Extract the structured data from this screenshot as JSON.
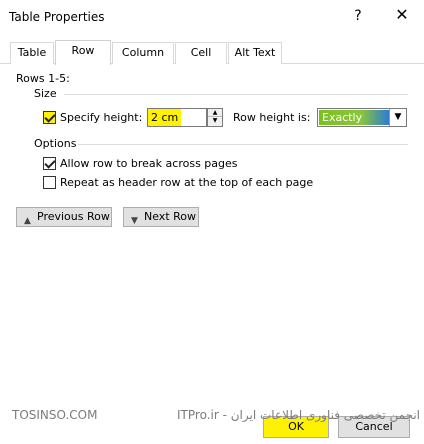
{
  "window": {
    "title": "Table Properties",
    "help_glyph": "?",
    "close_glyph": "✕"
  },
  "tabs": [
    {
      "label": "Table"
    },
    {
      "label": "Row"
    },
    {
      "label": "Column"
    },
    {
      "label": "Cell"
    },
    {
      "label": "Alt Text"
    }
  ],
  "row_panel": {
    "rows_label": "Rows 1-5:",
    "size_group": "Size",
    "specify_height_label": "Specify height:",
    "specify_height_checked": true,
    "height_value": "2 cm",
    "row_height_is_label": "Row height is:",
    "row_height_is_value": "Exactly",
    "options_group": "Options",
    "allow_break_label": "Allow row to break across pages",
    "allow_break_checked": true,
    "repeat_header_label": "Repeat as header row at the top of each page",
    "repeat_header_checked": false,
    "previous_row_label": "Previous Row",
    "next_row_label": "Next Row"
  },
  "footer": {
    "ok_label": "OK",
    "cancel_label": "Cancel"
  },
  "watermark": {
    "left_text": "TOSINSO.COM",
    "right_text": "انجمن تخصصی فناوری اطلاعات ایران - ITPro.ir"
  },
  "colors": {
    "highlight": "#fff200",
    "select_green": "#7bbf1e",
    "select_blue": "#2d7bd6"
  }
}
